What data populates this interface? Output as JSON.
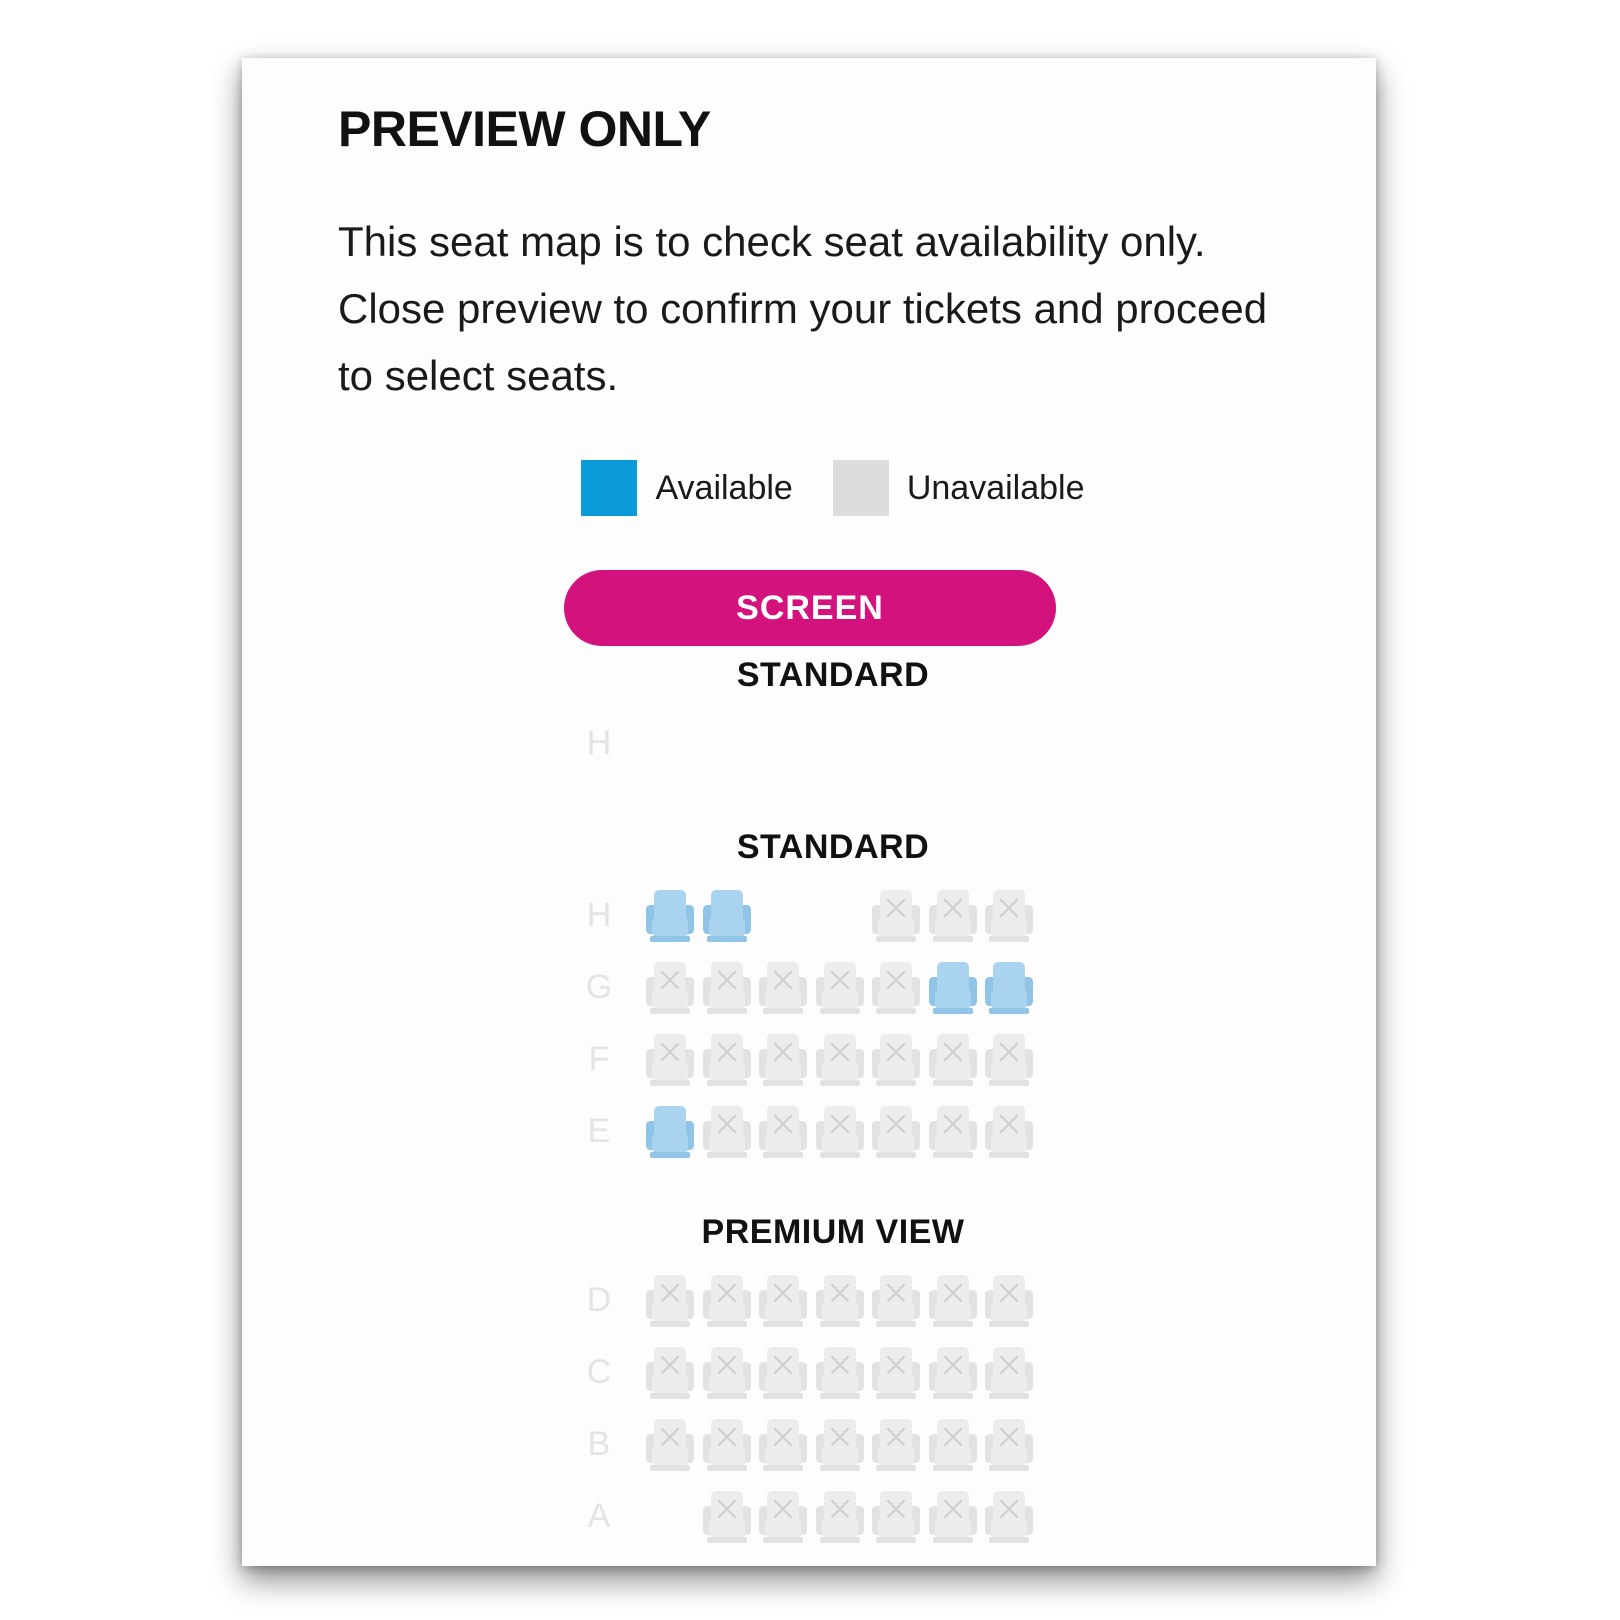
{
  "modal": {
    "title": "PREVIEW ONLY",
    "description": "This seat map is to check seat availability only. Close preview to confirm your tickets and proceed to select seats."
  },
  "legend": {
    "available_label": "Available",
    "unavailable_label": "Unavailable",
    "available_color": "#0a9bd8",
    "unavailable_color": "#dddddd"
  },
  "screen_label": "SCREEN",
  "colors": {
    "screen": "#d3127d",
    "seat_available": "#a9d3ee",
    "seat_unavailable": "#ececec",
    "row_label": "#e4e4e4"
  },
  "sections": [
    {
      "label": "STANDARD",
      "rows": [
        {
          "label": "H",
          "seats": [
            "empty",
            "empty",
            "empty",
            "empty",
            "empty",
            "empty",
            "empty"
          ]
        }
      ]
    },
    {
      "label": "STANDARD",
      "rows": [
        {
          "label": "H",
          "seats": [
            "available",
            "available",
            "empty",
            "empty",
            "unavailable",
            "unavailable",
            "unavailable"
          ]
        },
        {
          "label": "G",
          "seats": [
            "unavailable",
            "unavailable",
            "unavailable",
            "unavailable",
            "unavailable",
            "available",
            "available"
          ]
        },
        {
          "label": "F",
          "seats": [
            "unavailable",
            "unavailable",
            "unavailable",
            "unavailable",
            "unavailable",
            "unavailable",
            "unavailable"
          ]
        },
        {
          "label": "E",
          "seats": [
            "available",
            "unavailable",
            "unavailable",
            "unavailable",
            "unavailable",
            "unavailable",
            "unavailable"
          ]
        }
      ]
    },
    {
      "label": "PREMIUM VIEW",
      "rows": [
        {
          "label": "D",
          "seats": [
            "unavailable",
            "unavailable",
            "unavailable",
            "unavailable",
            "unavailable",
            "unavailable",
            "unavailable"
          ]
        },
        {
          "label": "C",
          "seats": [
            "unavailable",
            "unavailable",
            "unavailable",
            "unavailable",
            "unavailable",
            "unavailable",
            "unavailable"
          ]
        },
        {
          "label": "B",
          "seats": [
            "unavailable",
            "unavailable",
            "unavailable",
            "unavailable",
            "unavailable",
            "unavailable",
            "unavailable"
          ]
        },
        {
          "label": "A",
          "seats": [
            "empty",
            "unavailable",
            "unavailable",
            "unavailable",
            "unavailable",
            "unavailable",
            "unavailable"
          ]
        }
      ]
    }
  ]
}
